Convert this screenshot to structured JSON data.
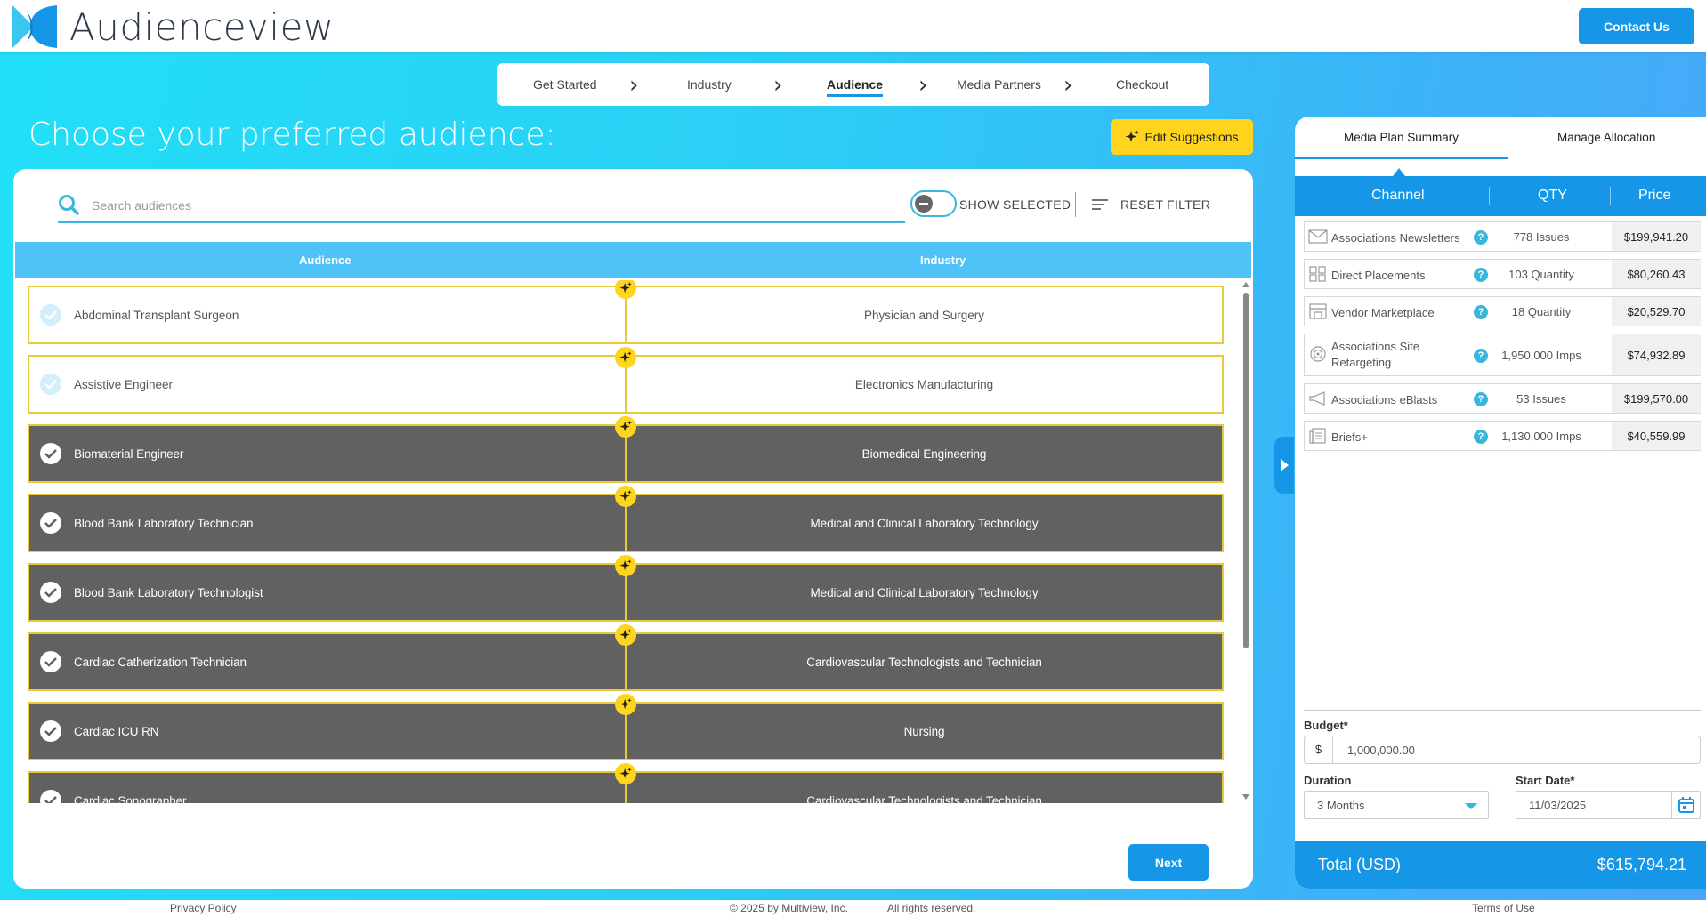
{
  "header": {
    "brand": "Audienceview",
    "contact_label": "Contact Us",
    "brand_colors": {
      "dark": "#1596e6",
      "light": "#39c6f0"
    }
  },
  "stepper": {
    "steps": [
      "Get Started",
      "Industry",
      "Audience",
      "Media Partners",
      "Checkout"
    ],
    "active": "Audience"
  },
  "main": {
    "title": "Choose your preferred audience:",
    "edit_suggestions_label": "Edit Suggestions",
    "search_placeholder": "Search audiences",
    "show_selected_label": "SHOW SELECTED",
    "reset_filter_label": "RESET FILTER",
    "columns": [
      "Audience",
      "Industry"
    ],
    "rows": [
      {
        "audience": "Abdominal Transplant Surgeon",
        "industry": "Physician and Surgery",
        "selected": false
      },
      {
        "audience": "Assistive Engineer",
        "industry": "Electronics Manufacturing",
        "selected": false
      },
      {
        "audience": "Biomaterial Engineer",
        "industry": "Biomedical Engineering",
        "selected": true
      },
      {
        "audience": "Blood Bank Laboratory Technician",
        "industry": "Medical and Clinical Laboratory Technology",
        "selected": true
      },
      {
        "audience": "Blood Bank Laboratory Technologist",
        "industry": "Medical and Clinical Laboratory Technology",
        "selected": true
      },
      {
        "audience": "Cardiac Catherization Technician",
        "industry": "Cardiovascular Technologists and Technician",
        "selected": true
      },
      {
        "audience": "Cardiac ICU RN",
        "industry": "Nursing",
        "selected": true
      },
      {
        "audience": "Cardiac Sonographer",
        "industry": "Cardiovascular Technologists and Technician",
        "selected": true
      }
    ],
    "next_label": "Next"
  },
  "side": {
    "tabs": [
      "Media Plan Summary",
      "Manage Allocation"
    ],
    "active_tab": "Media Plan Summary",
    "columns": [
      "Channel",
      "QTY",
      "Price"
    ],
    "channels": [
      {
        "name": "Associations Newsletters",
        "qty": "778 Issues",
        "price": "$199,941.20",
        "icon": "envelope-icon"
      },
      {
        "name": "Direct Placements",
        "qty": "103 Quantity",
        "price": "$80,260.43",
        "icon": "grid-icon"
      },
      {
        "name": "Vendor Marketplace",
        "qty": "18 Quantity",
        "price": "$20,529.70",
        "icon": "store-icon"
      },
      {
        "name": "Associations Site Retargeting",
        "qty": "1,950,000 Imps",
        "price": "$74,932.89",
        "icon": "target-icon"
      },
      {
        "name": "Associations eBlasts",
        "qty": "53 Issues",
        "price": "$199,570.00",
        "icon": "megaphone-icon"
      },
      {
        "name": "Briefs+",
        "qty": "1,130,000 Imps",
        "price": "$40,559.99",
        "icon": "document-icon"
      }
    ],
    "help_glyph": "?",
    "budget_label": "Budget*",
    "currency": "$",
    "budget_value": "1,000,000.00",
    "duration_label": "Duration",
    "duration_value": "3 Months",
    "start_date_label": "Start Date*",
    "start_date_value": "11/03/2025",
    "total_label": "Total (USD)",
    "total_value": "$615,794.21"
  },
  "footer": {
    "privacy": "Privacy Policy",
    "copyright": "© 2025 by Multiview, Inc.",
    "rights": "All rights reserved.",
    "terms": "Terms of Use"
  }
}
